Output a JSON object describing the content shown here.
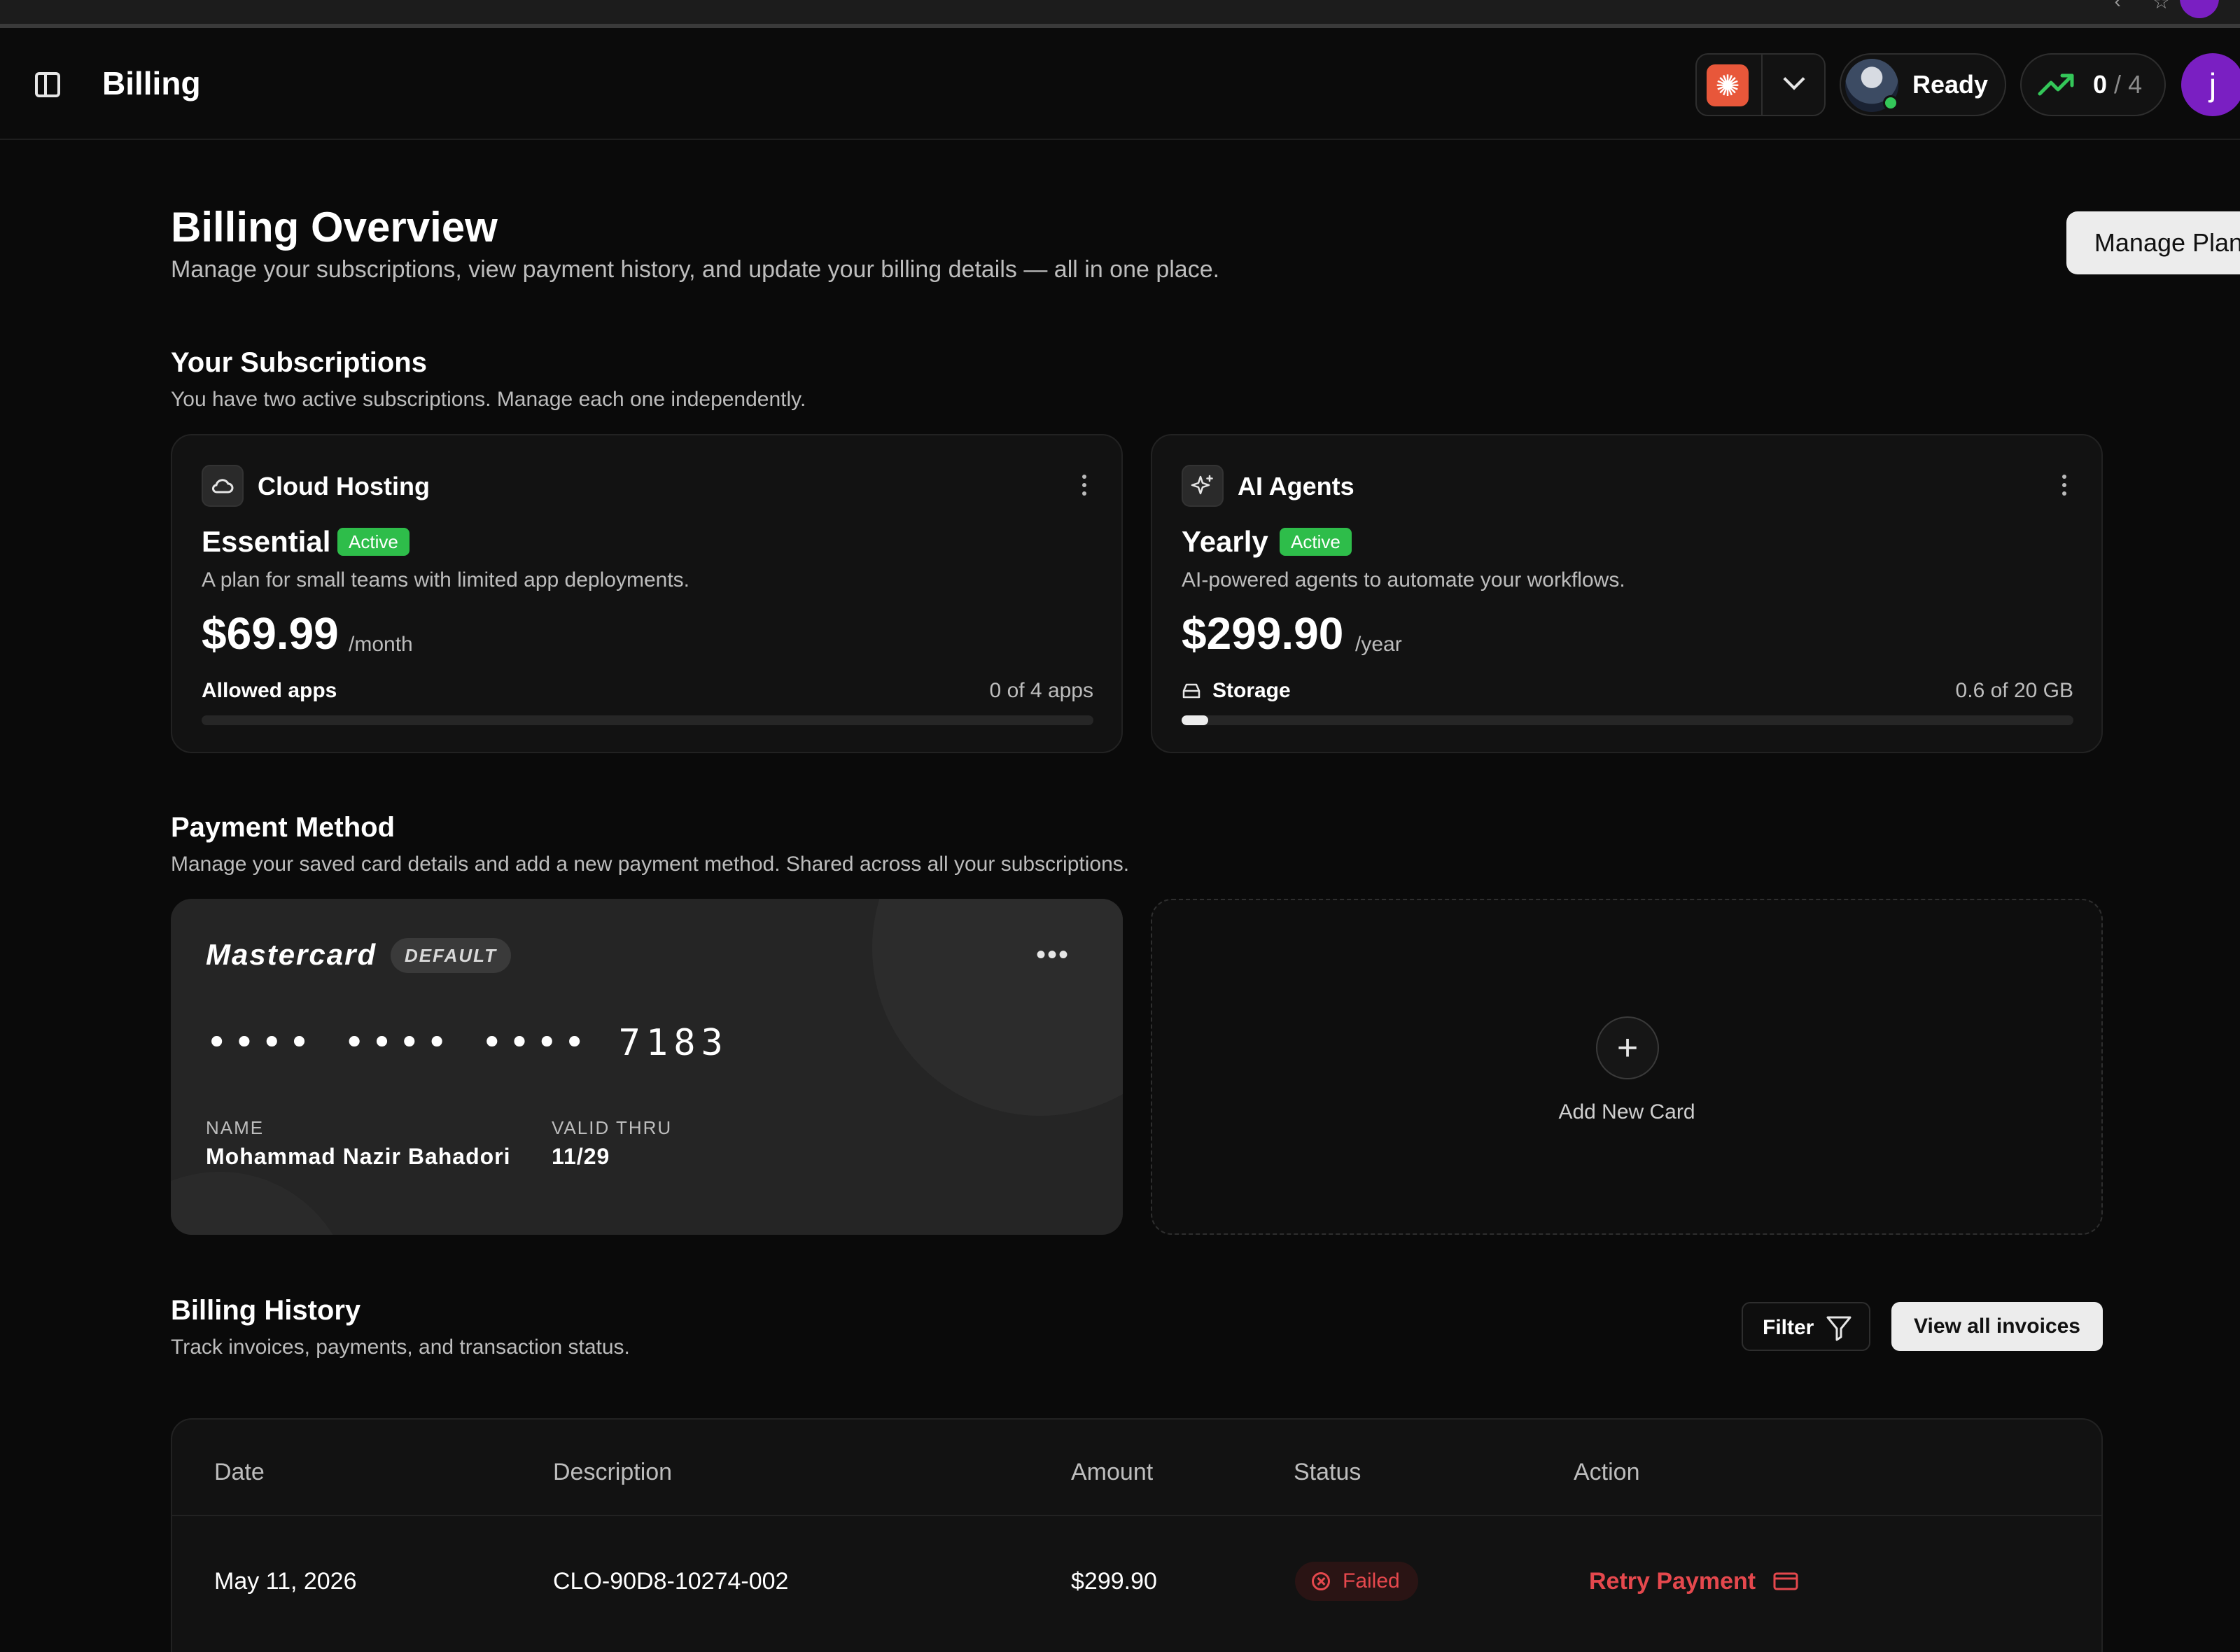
{
  "header": {
    "title": "Billing",
    "status": "Ready",
    "usage": {
      "used": "0",
      "separator": "/",
      "limit": "4"
    },
    "user_initial": "j"
  },
  "page": {
    "title": "Billing Overview",
    "subtitle": "Manage your subscriptions, view payment history, and update your billing details — all in one place.",
    "manage_plan_label": "Manage Plan"
  },
  "subscriptions": {
    "title": "Your Subscriptions",
    "subtitle": "You have two active subscriptions. Manage each one independently.",
    "items": [
      {
        "service": "Cloud Hosting",
        "icon": "cloud-icon",
        "plan": "Essential",
        "status": "Active",
        "description": "A plan for small teams with limited app deployments.",
        "price": "$69.99",
        "period": "/month",
        "usage_label": "Allowed apps",
        "usage_value": "0 of 4 apps",
        "usage_fraction": 0
      },
      {
        "service": "AI Agents",
        "icon": "sparkles-icon",
        "plan": "Yearly",
        "status": "Active",
        "description": "AI-powered agents to automate your workflows.",
        "price": "$299.90",
        "period": "/year",
        "usage_label": "Storage",
        "usage_value": "0.6 of 20 GB",
        "usage_fraction": 0.03
      }
    ]
  },
  "payment": {
    "title": "Payment Method",
    "subtitle": "Manage your saved card details and add a new payment method. Shared across all your subscriptions.",
    "card": {
      "brand": "Mastercard",
      "badge": "DEFAULT",
      "number": "•••• •••• •••• 7183",
      "name_label": "NAME",
      "name": "Mohammad Nazir Bahadori",
      "valid_label": "VALID THRU",
      "valid": "11/29"
    },
    "add_card_label": "Add New Card"
  },
  "history": {
    "title": "Billing History",
    "subtitle": "Track invoices, payments, and transaction status.",
    "filter_label": "Filter",
    "view_all_label": "View all invoices",
    "columns": [
      "Date",
      "Description",
      "Amount",
      "Status",
      "Action"
    ],
    "rows": [
      {
        "date": "May 11, 2026",
        "description": "CLO-90D8-10274-002",
        "amount": "$299.90",
        "status": "Failed",
        "action": "Retry Payment"
      }
    ]
  },
  "colors": {
    "background": "#0a0a0a",
    "card": "#121212",
    "active_badge": "#2ebd4a",
    "danger": "#e5484d",
    "accent_purple": "#7a1fc2",
    "model_logo": "#e8573a"
  }
}
